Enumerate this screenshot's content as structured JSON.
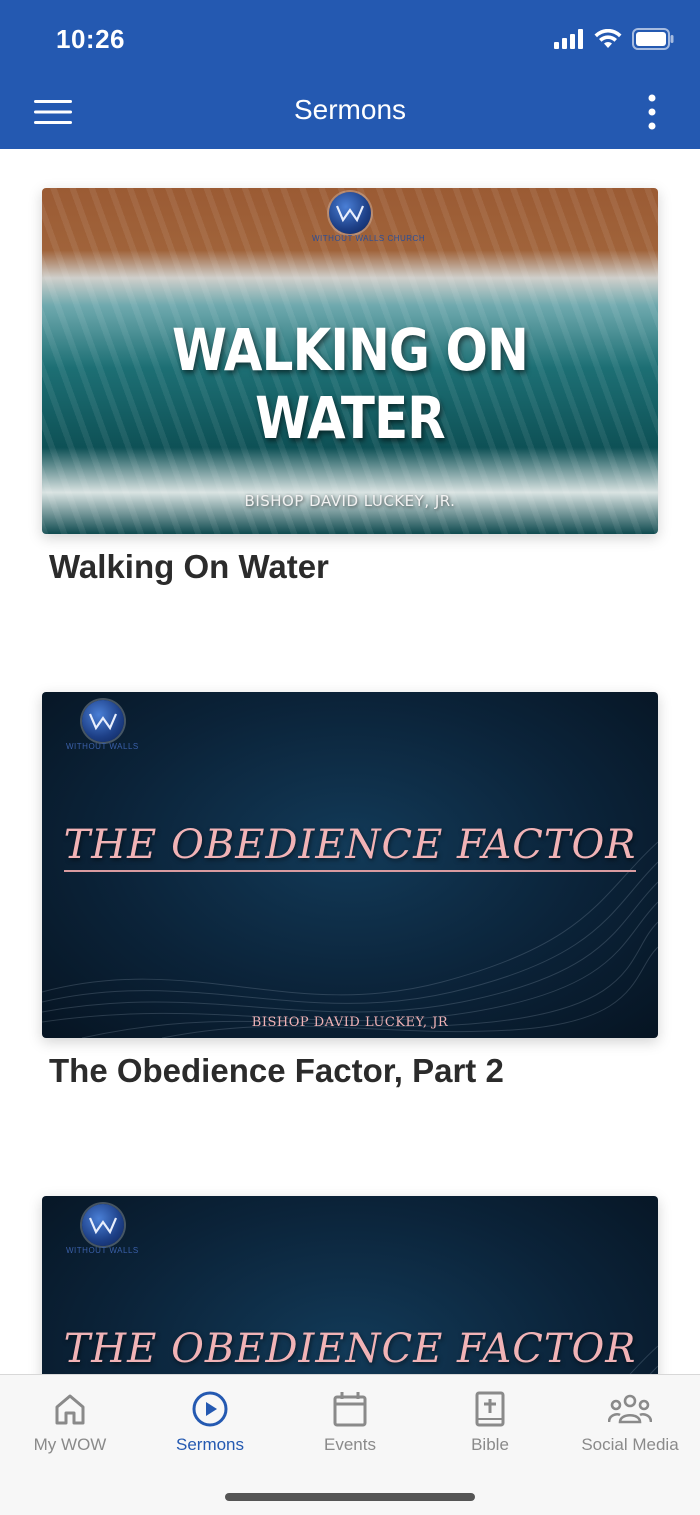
{
  "status_bar": {
    "time": "10:26"
  },
  "header": {
    "title": "Sermons"
  },
  "sermons": [
    {
      "title": "Walking On Water",
      "thumbnail": {
        "headline": "WALKING ON WATER",
        "speaker": "BISHOP DAVID LUCKEY, JR.",
        "logo_text": "WITHOUT WALLS CHURCH"
      }
    },
    {
      "title": "The Obedience Factor, Part 2",
      "thumbnail": {
        "headline": "THE OBEDIENCE FACTOR",
        "speaker": "BISHOP DAVID LUCKEY, JR",
        "logo_text": "WITHOUT WALLS"
      }
    },
    {
      "title": "",
      "thumbnail": {
        "headline": "THE OBEDIENCE FACTOR",
        "speaker": "",
        "logo_text": "WITHOUT WALLS"
      }
    }
  ],
  "tabs": [
    {
      "label": "My WOW",
      "icon": "home-icon",
      "active": false
    },
    {
      "label": "Sermons",
      "icon": "play-circle-icon",
      "active": true
    },
    {
      "label": "Events",
      "icon": "calendar-icon",
      "active": false
    },
    {
      "label": "Bible",
      "icon": "bible-icon",
      "active": false
    },
    {
      "label": "Social Media",
      "icon": "group-icon",
      "active": false
    }
  ],
  "colors": {
    "brand": "#2459b1",
    "tab_inactive": "#8a8a8a",
    "title_text": "#2b2b2b"
  }
}
